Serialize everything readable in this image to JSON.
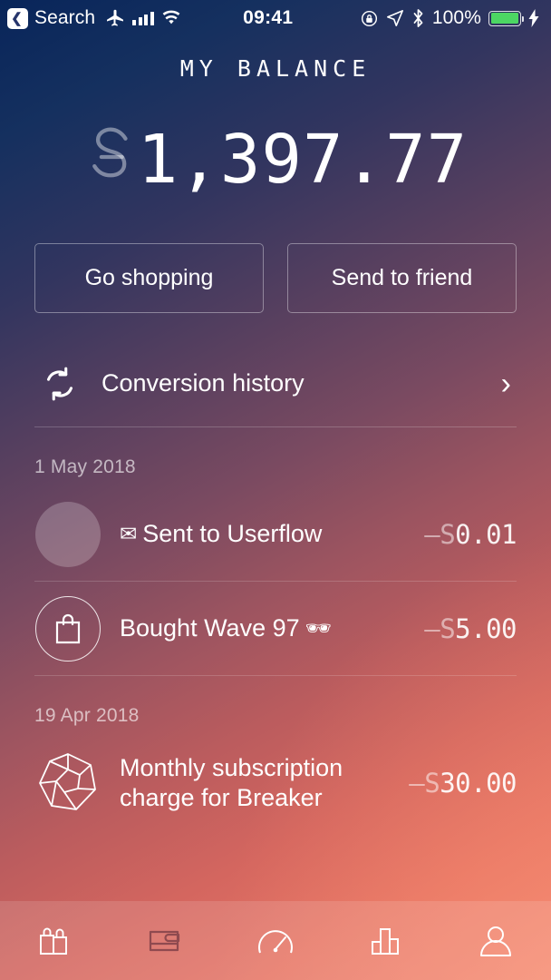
{
  "status_bar": {
    "back_label": "Search",
    "back_icon": "chevron-left-icon",
    "airplane_icon": "airplane-mode-icon",
    "signal_icon": "cellular-signal-icon",
    "wifi_icon": "wifi-icon",
    "time": "09:41",
    "rotation_lock_icon": "rotation-lock-icon",
    "location_icon": "location-arrow-icon",
    "bluetooth_icon": "bluetooth-icon",
    "battery_percent": "100%",
    "battery_icon": "battery-full-icon",
    "charging_icon": "lightning-bolt-icon",
    "battery_color": "#4cd663"
  },
  "header": {
    "title": "MY BALANCE",
    "currency_symbol": "S",
    "balance": "1,397.77"
  },
  "actions": {
    "shopping_label": "Go shopping",
    "send_label": "Send to friend"
  },
  "conversion": {
    "label": "Conversion history",
    "icon": "exchange-arrows-icon",
    "chevron": "›"
  },
  "transactions": {
    "groups": [
      {
        "date": "1 May 2018",
        "items": [
          {
            "icon": "avatar-placeholder",
            "emoji": "✉",
            "label": "Sent to Userflow",
            "sign": "–",
            "currency": "S",
            "amount": "0.01"
          },
          {
            "icon": "shopping-bag-icon",
            "emoji": "🕶",
            "label": "Bought Wave 97",
            "sign": "–",
            "currency": "S",
            "amount": "5.00"
          }
        ]
      },
      {
        "date": "19 Apr 2018",
        "items": [
          {
            "icon": "dodecahedron-icon",
            "emoji": "",
            "label": "Monthly subscription charge for Breaker",
            "sign": "–",
            "currency": "S",
            "amount": "30.00"
          }
        ]
      }
    ]
  },
  "tabbar": {
    "items": [
      {
        "icon": "shopping-bags-icon",
        "active": false
      },
      {
        "icon": "wallet-icon",
        "active": true
      },
      {
        "icon": "gauge-icon",
        "active": false
      },
      {
        "icon": "bar-chart-icon",
        "active": false
      },
      {
        "icon": "person-icon",
        "active": false
      }
    ],
    "active_color": "#8f4a4f",
    "inactive_color": "#ffffff"
  }
}
